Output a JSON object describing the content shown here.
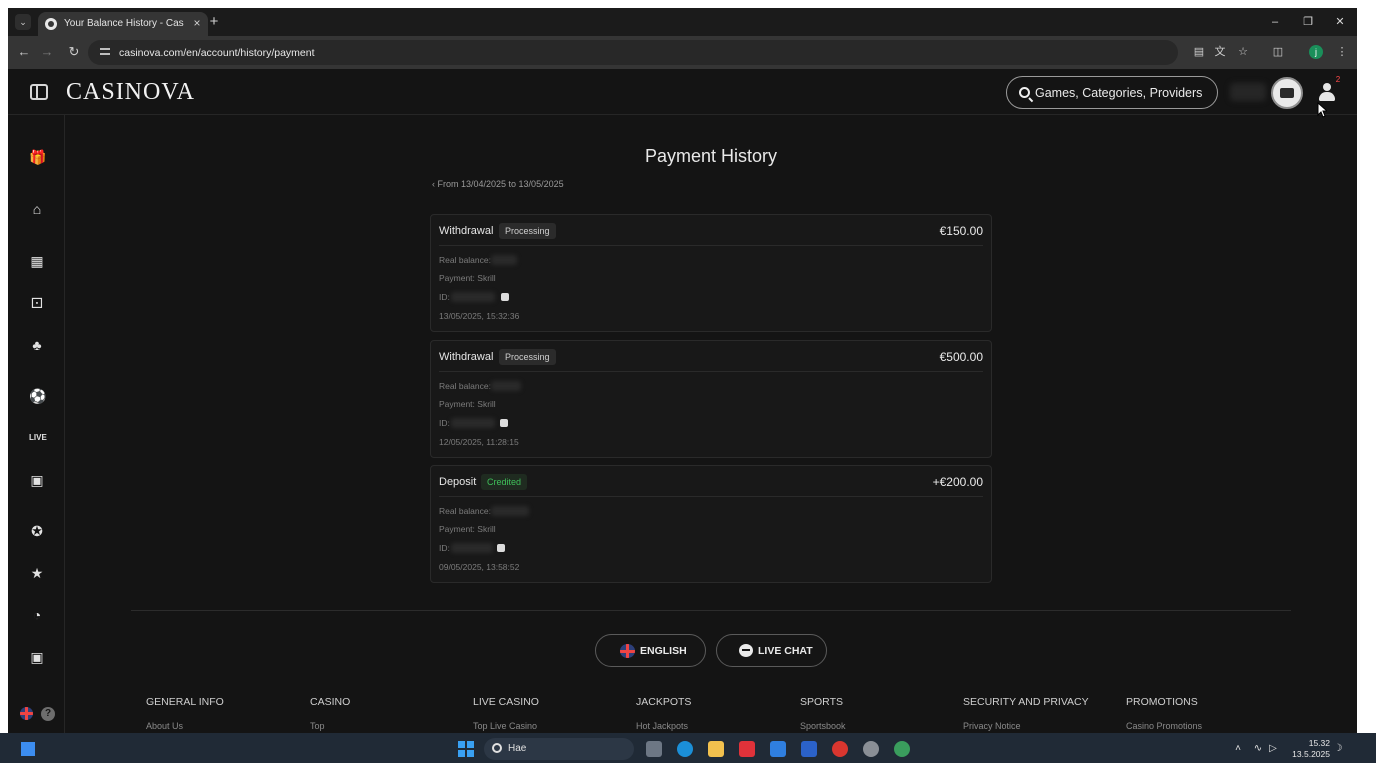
{
  "browser": {
    "tab_title": "Your Balance History - Casinova",
    "url": "casinova.com/en/account/history/payment",
    "profile_initial": "j"
  },
  "header": {
    "logo": "CASINOVA",
    "search_placeholder": "Games, Categories, Providers",
    "notification_count": "2"
  },
  "page": {
    "title": "Payment History",
    "range": "From 13/04/2025 to 13/05/2025"
  },
  "labels": {
    "real_balance": "Real balance:",
    "payment": "Payment:",
    "id": "ID:"
  },
  "transactions": [
    {
      "type": "Withdrawal",
      "status": "Processing",
      "amount": "€150.00",
      "payment": "Skrill",
      "date": "13/05/2025, 15:32:36"
    },
    {
      "type": "Withdrawal",
      "status": "Processing",
      "amount": "€500.00",
      "payment": "Skrill",
      "date": "12/05/2025, 11:28:15"
    },
    {
      "type": "Deposit",
      "status": "Credited",
      "amount": "+€200.00",
      "payment": "Skrill",
      "date": "09/05/2025, 13:58:52"
    }
  ],
  "footer": {
    "language_button": "ENGLISH",
    "chat_button": "LIVE CHAT",
    "columns": [
      {
        "heading": "GENERAL INFO",
        "link": "About Us"
      },
      {
        "heading": "CASINO",
        "link": "Top"
      },
      {
        "heading": "LIVE CASINO",
        "link": "Top Live Casino"
      },
      {
        "heading": "JACKPOTS",
        "link": "Hot Jackpots"
      },
      {
        "heading": "SPORTS",
        "link": "Sportsbook"
      },
      {
        "heading": "SECURITY AND PRIVACY",
        "link": "Privacy Notice"
      },
      {
        "heading": "PROMOTIONS",
        "link": "Casino Promotions"
      }
    ]
  },
  "taskbar": {
    "search_text": "Hae",
    "time": "15.32",
    "date": "13.5.2025"
  },
  "colors": {
    "site_bg": "#141414",
    "card_bg": "#181818",
    "credited_green": "#3fc05a",
    "taskbar_bg": "#202a36"
  },
  "icons": [
    "gift-icon",
    "home-icon",
    "slot-machine-icon",
    "dice-icon",
    "clover-icon",
    "soccer-ball-icon",
    "live-icon",
    "tv-icon",
    "medal-icon",
    "trophy-icon",
    "sport-icon",
    "vehicle-icon"
  ]
}
